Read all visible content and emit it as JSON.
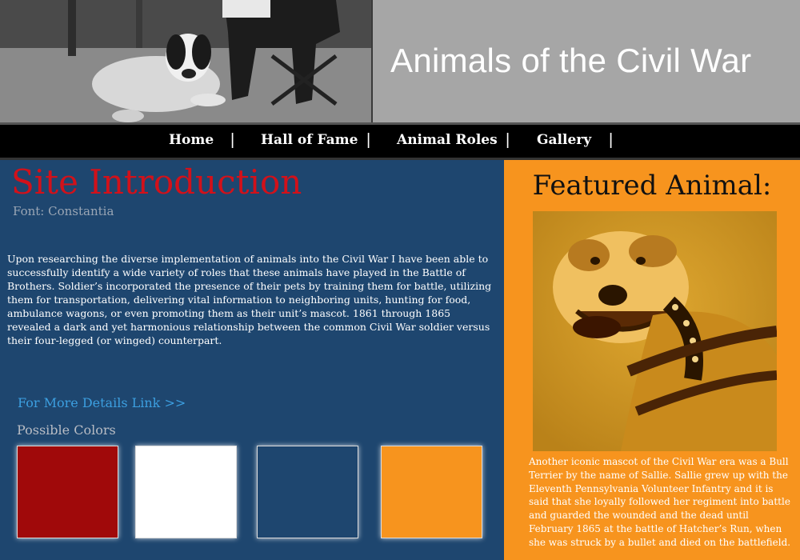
{
  "header": {
    "title": "Animals of the Civil War",
    "photo_icon": "dog-with-soldier-photo"
  },
  "nav": {
    "items": [
      {
        "label": "Home"
      },
      {
        "label": "Hall of Fame"
      },
      {
        "label": "Animal Roles"
      },
      {
        "label": "Gallery"
      }
    ],
    "separator": "|"
  },
  "intro": {
    "title": "Site Introduction",
    "font_note": "Font: Constantia",
    "body": "Upon researching the diverse implementation of animals into the Civil War I have been able to successfully identify a wide variety of roles that these animals have played in the Battle of Brothers. Soldier’s incorporated the presence of their pets by training them for battle, utilizing them for transportation, delivering vital information to neighboring units, hunting for food, ambulance wagons, or even promoting them as their unit’s mascot.  1861 through 1865 revealed a dark and yet harmonious relationship between the common Civil War soldier versus their four-legged (or winged) counterpart.",
    "details_link": "For More Details Link >>",
    "colors_label": "Possible Colors",
    "colors": [
      "#a0090a",
      "#ffffff",
      "#1e466f",
      "#f7941e"
    ]
  },
  "featured": {
    "title": "Featured Animal:",
    "photo_icon": "bull-terrier-sallie-photo",
    "text": "Another iconic mascot of the Civil War era was a Bull Terrier by the name of Sallie. Sallie grew up with the Eleventh Pennsylvania Volunteer Infantry and it is said that she loyally followed her regiment into battle and guarded the wounded and the dead until February 1865 at the battle of Hatcher’s Run, when she was struck by a bullet and died on the battlefield."
  }
}
